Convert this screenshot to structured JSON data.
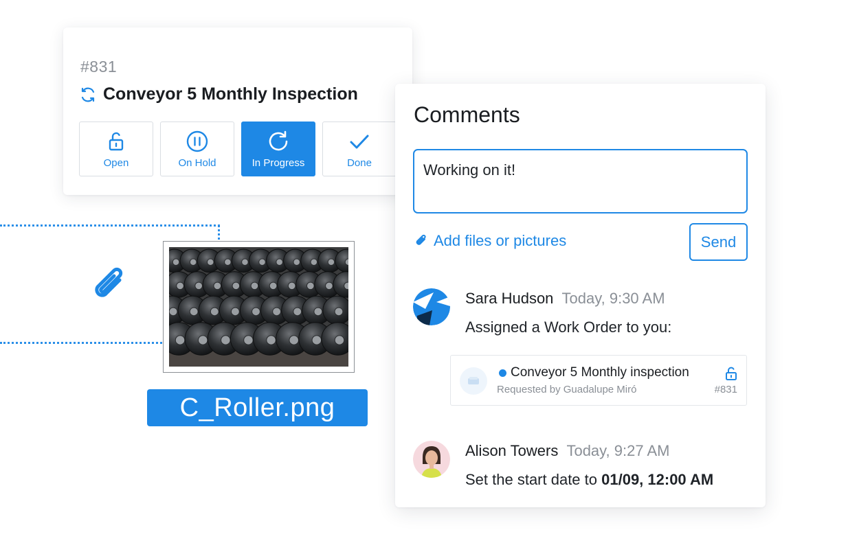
{
  "work_order": {
    "id": "#831",
    "title": "Conveyor 5 Monthly Inspection",
    "statuses": [
      {
        "label": "Open",
        "icon": "unlock-icon"
      },
      {
        "label": "On Hold",
        "icon": "pause-icon"
      },
      {
        "label": "In Progress",
        "icon": "refresh-icon",
        "active": true
      },
      {
        "label": "Done",
        "icon": "check-icon"
      }
    ],
    "accent_color": "#1e88e5"
  },
  "attachment": {
    "file_name": "C_Roller.png"
  },
  "comments": {
    "title": "Comments",
    "input_value": "Working on it!",
    "add_files_label": "Add files or pictures",
    "send_label": "Send",
    "items": [
      {
        "author": "Sara Hudson",
        "time": "Today, 9:30 AM",
        "text": "Assigned a Work Order to you:",
        "work_order_ref": {
          "title": "Conveyor 5 Monthly inspection",
          "requested_by": "Requested by Guadalupe Miró",
          "number": "#831"
        }
      },
      {
        "author": "Alison Towers",
        "time": "Today, 9:27 AM",
        "text_prefix": "Set the start date to ",
        "text_bold": "01/09, 12:00 AM"
      }
    ]
  }
}
